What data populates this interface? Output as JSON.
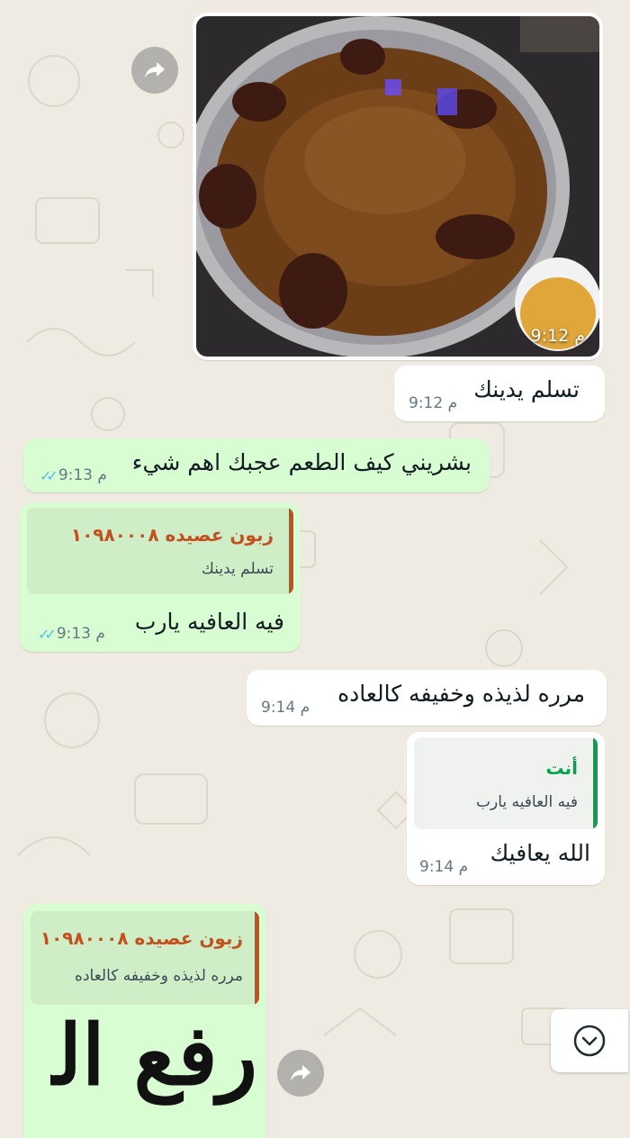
{
  "messages": {
    "m1": {
      "time": "9:12 م"
    },
    "m2": {
      "text": "تسلم يدينك",
      "time": "9:12 م"
    },
    "m3": {
      "text": "بشريني كيف الطعم عجبك اهم شيء",
      "time": "9:13 م"
    },
    "m4": {
      "quote_author": "زبون عصيده ١٠٩٨٠٠٠٨",
      "quote_text": "تسلم يدينك",
      "text": "فيه العافيه يارب",
      "time": "9:13 م"
    },
    "m5": {
      "text": "مرره لذيذه وخفيفه كالعاده",
      "time": "9:14 م"
    },
    "m6": {
      "quote_author": "أنت",
      "quote_text": "فيه العافيه يارب",
      "text": "الله يعافيك",
      "time": "9:14 م"
    },
    "m7": {
      "quote_author": "زبون عصيده ١٠٩٨٠٠٠٨",
      "quote_text": "مرره لذيذه وخفيفه كالعاده",
      "sticker_text": "رفع الله"
    }
  },
  "colors": {
    "incoming_bubble": "#ffffff",
    "outgoing_bubble": "#d9fdd3",
    "wallpaper": "#efeae2",
    "customer_name": "#c4501d",
    "you_name": "#06a34e",
    "read_ticks": "#53bdeb"
  },
  "icons": {
    "forward": "forward-arrow-icon",
    "scroll_down": "chevron-down-icon",
    "read_receipt": "double-check-icon"
  }
}
